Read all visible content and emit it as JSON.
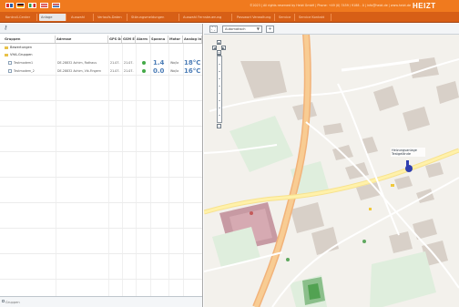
{
  "topbar": {
    "copyright": "©2023 | All rights reserved by Heizt GmbH | Phone: +49 (0) 7459 / 9188 - 0 | info@heizt.de | www.heizt.de",
    "logo": "HEIZT",
    "flags": [
      "uk",
      "germany",
      "italy",
      "austria",
      "dutch"
    ]
  },
  "menu": [
    {
      "label": "Kontroll-Center",
      "active": false
    },
    {
      "label": "Anlage",
      "active": true
    },
    {
      "label": "Auswahl",
      "active": false
    },
    {
      "label": "Verlaufs-Daten",
      "active": false
    },
    {
      "label": "Störungsmeldungen",
      "active": false
    },
    {
      "label": "Auswahl Fernsteuerung",
      "active": false
    },
    {
      "label": "Passwort Verwaltung",
      "active": false
    },
    {
      "label": "Service",
      "active": false
    },
    {
      "label": "Service Kontakt",
      "active": false
    }
  ],
  "tree": {
    "headers": [
      "Gruppen",
      "Adresse",
      "GPS Da",
      "GSM En",
      "Alarm",
      "Spannu",
      "Motor",
      "Analog In"
    ],
    "groups": [
      {
        "label": "Bewertungen",
        "icon": "folder-icon"
      },
      {
        "label": "VHA-Gruppen",
        "icon": "folder-icon"
      }
    ],
    "rows": [
      {
        "name": "Testmodem1",
        "address": "DE-28832 Achim, Rathaus",
        "gps": "21.07.",
        "gsm": "21.07.",
        "spannung": "1.4",
        "motor": "Wa/la",
        "temp": "18°C"
      },
      {
        "name": "Testmodem_2",
        "address": "DE-28832 Achim, Vik-Fingern",
        "gps": "21.07.",
        "gsm": "21.07.",
        "spannung": "0.0",
        "motor": "Wa/la",
        "temp": "16°C"
      }
    ],
    "footer": "Gruppen"
  },
  "map": {
    "layer_select": "Automatisch",
    "nav_labels": [
      "+",
      "−"
    ],
    "poi_label": "Heizungsanlage Testgelände"
  },
  "colors": {
    "brand": "#f07a1e",
    "menu": "#d75f16",
    "green_dot": "#43a947",
    "value_blue": "#4c7db7"
  }
}
